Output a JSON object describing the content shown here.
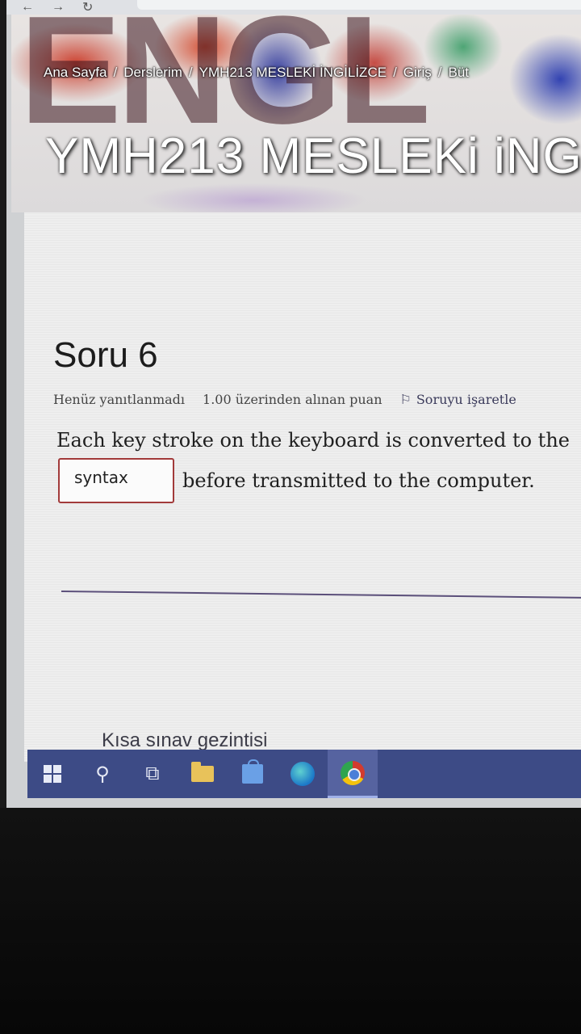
{
  "breadcrumb": [
    "Ana Sayfa",
    "Derslerim",
    "YMH213 MESLEKİ İNGİLİZCE",
    "Giriş",
    "Büt"
  ],
  "course": {
    "title": "YMH213 MESLEKi iNG"
  },
  "question": {
    "heading": "Soru 6",
    "status": "Henüz yanıtlanmadı",
    "points": "1.00 üzerinden alınan puan",
    "flag_label": "Soruyu işaretle",
    "text_before": "Each key stroke on the keyboard is converted to the",
    "answer_value": "syntax",
    "text_after": "before transmitted to the computer."
  },
  "navigation": {
    "title": "Kısa sınav gezintisi"
  },
  "taskbar": {
    "items": [
      "windows-start",
      "search",
      "task-view",
      "file-explorer",
      "microsoft-store",
      "edge",
      "chrome"
    ],
    "active": "chrome"
  },
  "colors": {
    "taskbar": "#3d4b86",
    "input_border": "#a23a3a",
    "divider": "#5b4f7a"
  }
}
